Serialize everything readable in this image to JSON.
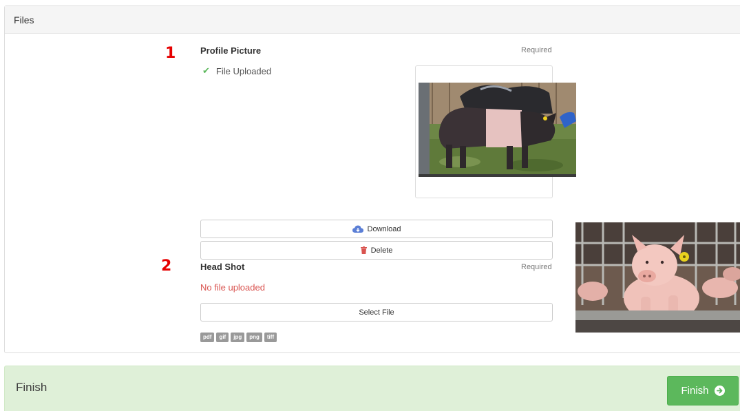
{
  "files_panel": {
    "title": "Files"
  },
  "markers": {
    "one": "1",
    "two": "2"
  },
  "profile_picture": {
    "title": "Profile Picture",
    "required": "Required",
    "status": "File Uploaded",
    "image": "pig-photo",
    "download_label": "Download",
    "delete_label": "Delete"
  },
  "head_shot": {
    "title": "Head Shot",
    "required": "Required",
    "status": "No file uploaded",
    "select_label": "Select File",
    "image": "piglet-photo",
    "file_types": [
      "pdf",
      "gif",
      "jpg",
      "png",
      "tiff"
    ]
  },
  "finish_panel": {
    "title": "Finish",
    "button_label": "Finish"
  },
  "colors": {
    "success": "#5cb85c",
    "danger": "#d9534f",
    "marker": "#e60000",
    "finish_bg": "#dff0d8",
    "download_icon": "#5b7fd6"
  },
  "icons": {
    "uploaded": "check-icon",
    "download": "cloud-download-icon",
    "delete": "trash-icon",
    "finish": "arrow-circle-right-icon"
  }
}
